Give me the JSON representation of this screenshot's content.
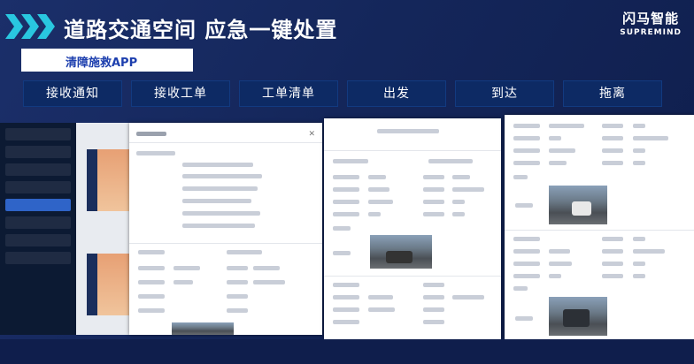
{
  "header": {
    "title": "道路交通空间 应急一键处置",
    "brand_cn": "闪马智能",
    "brand_en": "SUPREMIND",
    "chevron_color": "#29c7e0"
  },
  "subtitle": "清障施救APP",
  "steps": [
    "接收通知",
    "接收工单",
    "工单清单",
    "出发",
    "到达",
    "拖离"
  ],
  "colors": {
    "background": "#14265a",
    "step_bg": "#0d2a64",
    "accent": "#1d3fae"
  }
}
